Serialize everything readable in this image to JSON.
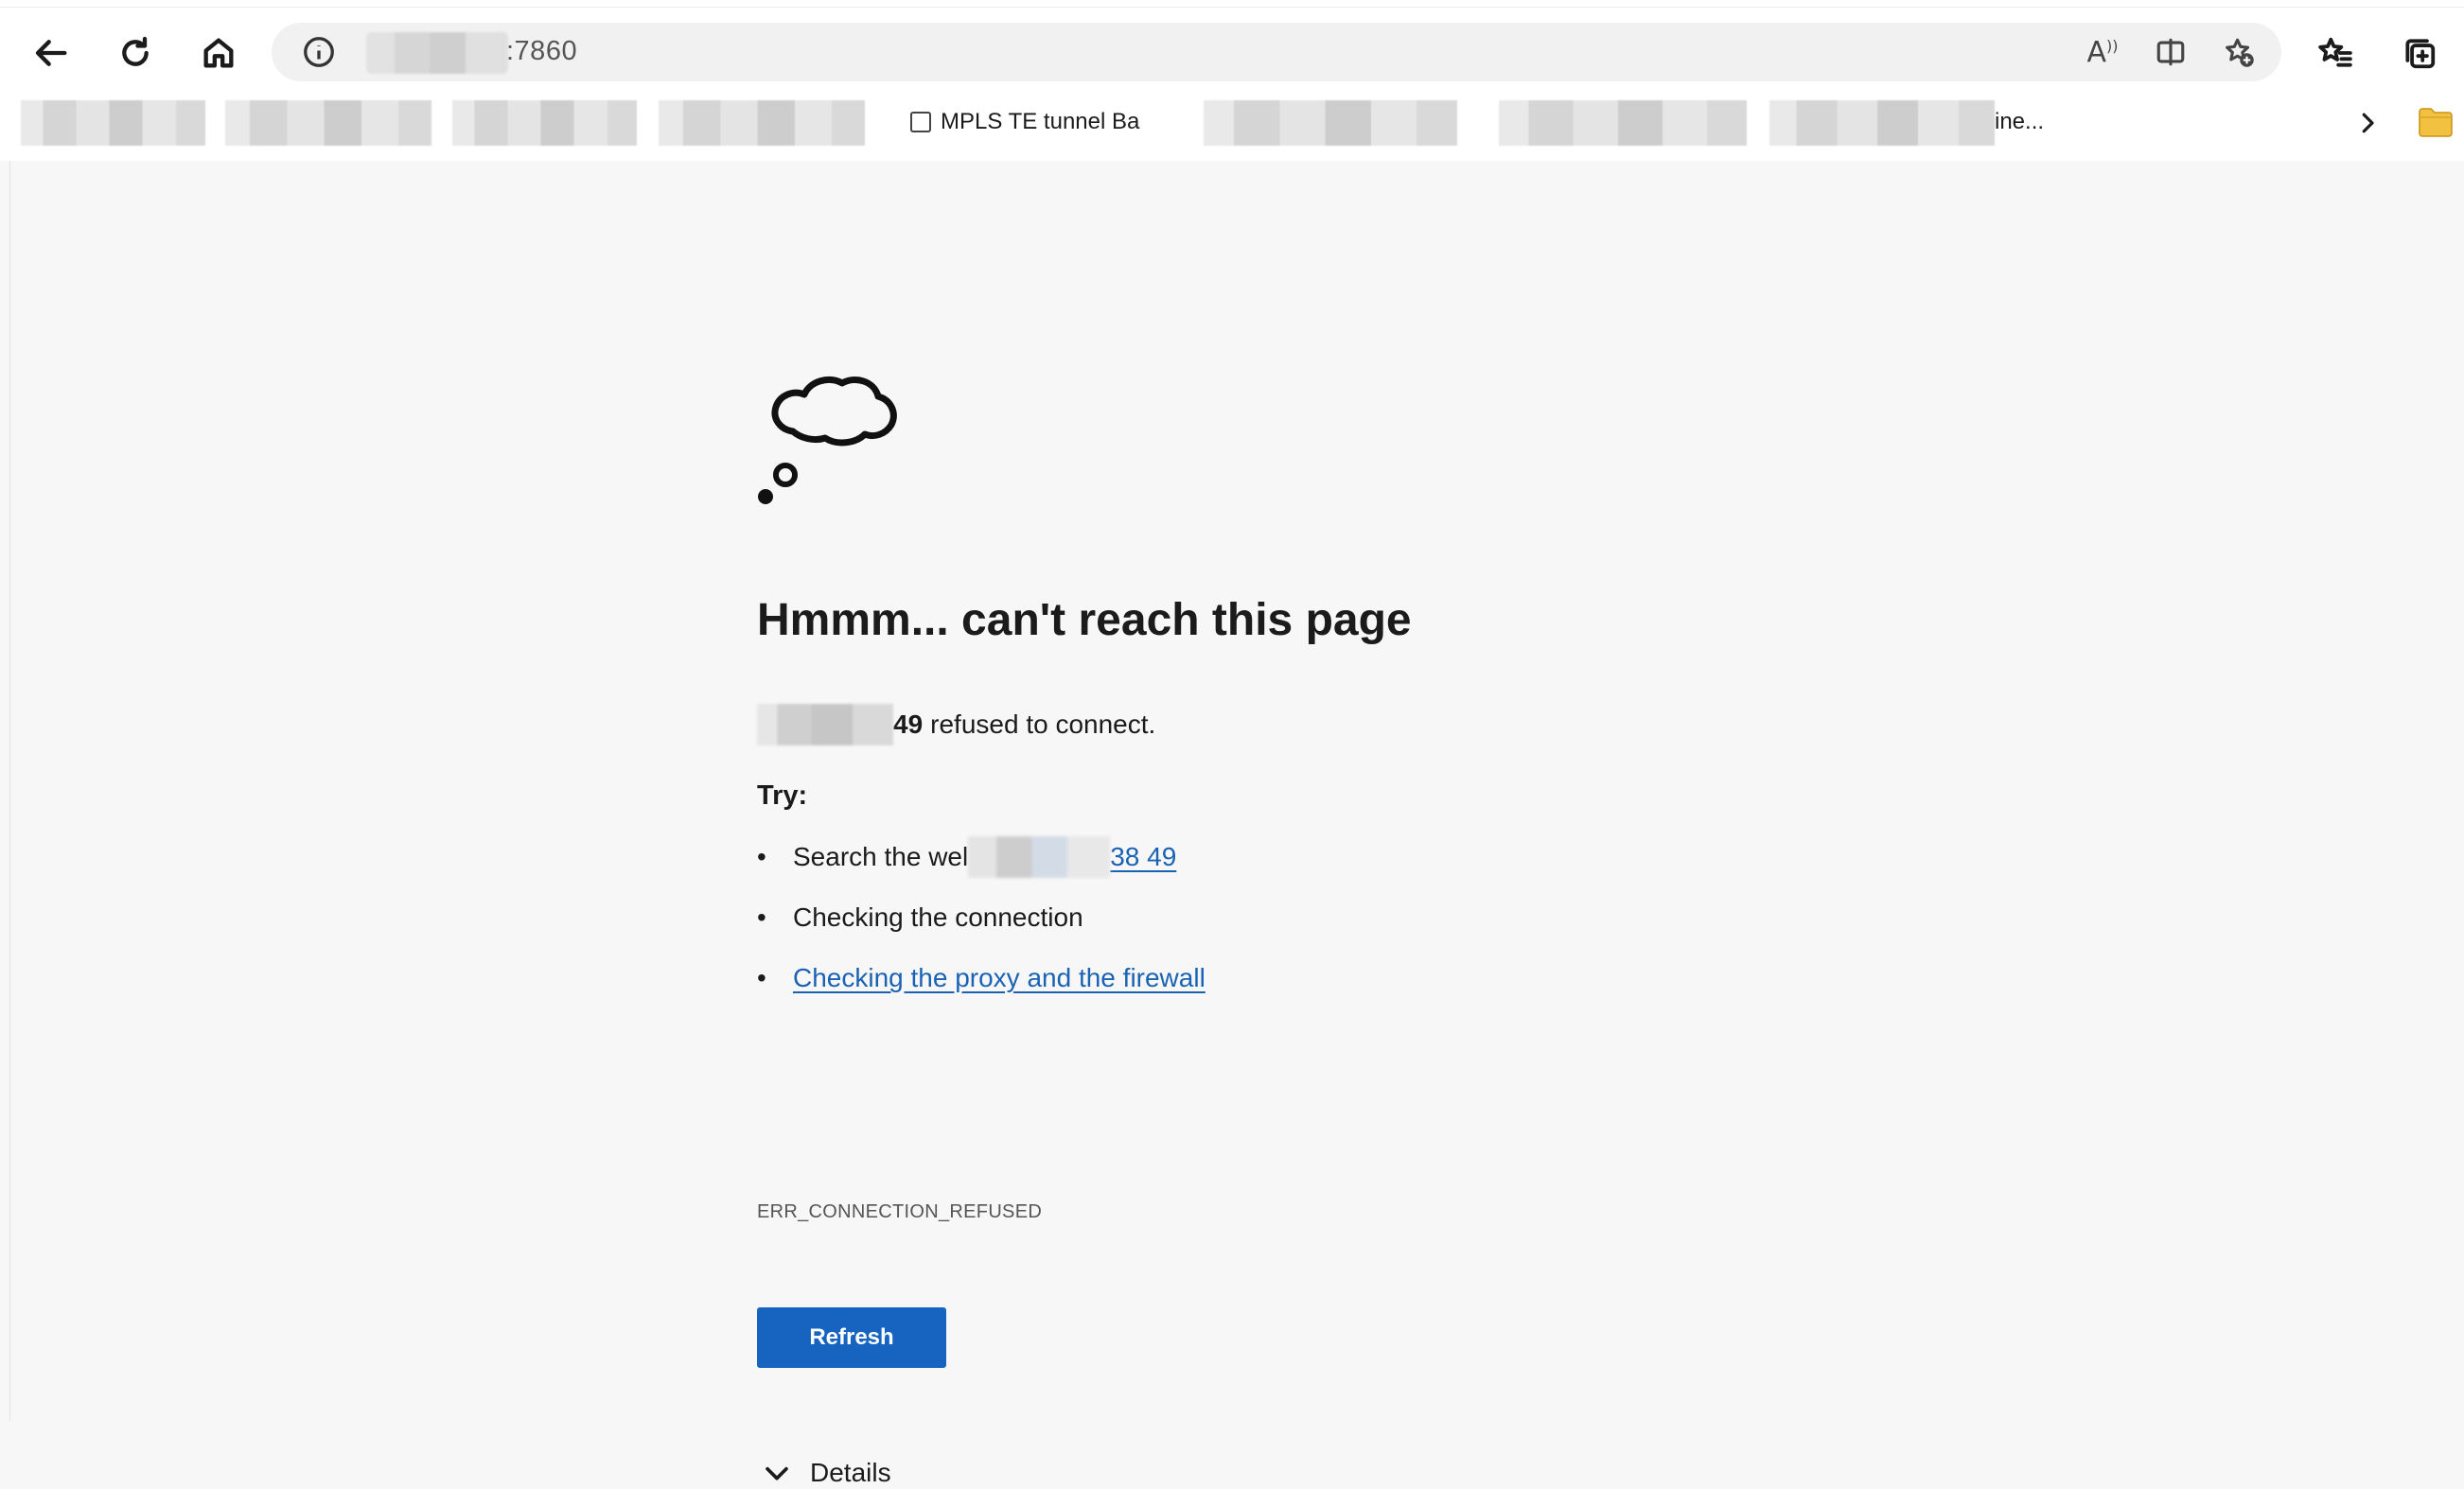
{
  "browser": {
    "address_bar": {
      "url_visible_suffix": ":7860"
    },
    "favorites": [
      {
        "label": "MPLS TE tunnel Ba"
      },
      {
        "label": "ine..."
      }
    ]
  },
  "error_page": {
    "heading": "Hmmm... can't reach this page",
    "host_suffix": "49",
    "refused_text": "refused to connect.",
    "try_label": "Try:",
    "suggestions": {
      "search_prefix": "Search the wel",
      "search_link_suffix": "38 49",
      "checking_connection": "Checking the connection",
      "proxy_firewall": "Checking the proxy and the firewall"
    },
    "error_code": "ERR_CONNECTION_REFUSED",
    "refresh_label": "Refresh",
    "details_label": "Details"
  },
  "colors": {
    "accent_blue": "#1764c0",
    "link_blue": "#1a62b4",
    "page_background": "#f7f7f7"
  },
  "icons": {
    "back": "back-arrow-icon",
    "reload": "reload-icon",
    "home": "home-icon",
    "site_info": "info-icon",
    "read_aloud": "read-aloud-icon",
    "split_screen": "split-screen-icon",
    "add_favorite": "add-favorite-icon",
    "favorites": "favorites-icon",
    "collections": "collections-icon",
    "error_illustration": "thought-cloud-icon"
  }
}
